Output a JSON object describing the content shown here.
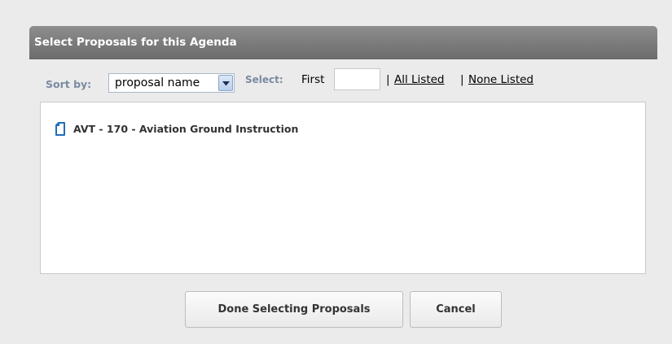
{
  "dialog": {
    "title": "Select Proposals for this Agenda"
  },
  "toolbar": {
    "sort_label": "Sort by:",
    "sort_value": "proposal name",
    "select_label": "Select:",
    "first_label": "First",
    "first_value": "",
    "separator": "|",
    "all_listed": "All Listed",
    "none_listed": "None Listed"
  },
  "proposals": [
    {
      "label": "AVT - 170 - Aviation Ground Instruction",
      "icon": "document-icon"
    }
  ],
  "buttons": {
    "done": "Done Selecting Proposals",
    "cancel": "Cancel"
  },
  "colors": {
    "header_bg": "#7b7b7b",
    "label_blue_gray": "#7b8aa0",
    "icon_blue": "#1f6fb8"
  }
}
